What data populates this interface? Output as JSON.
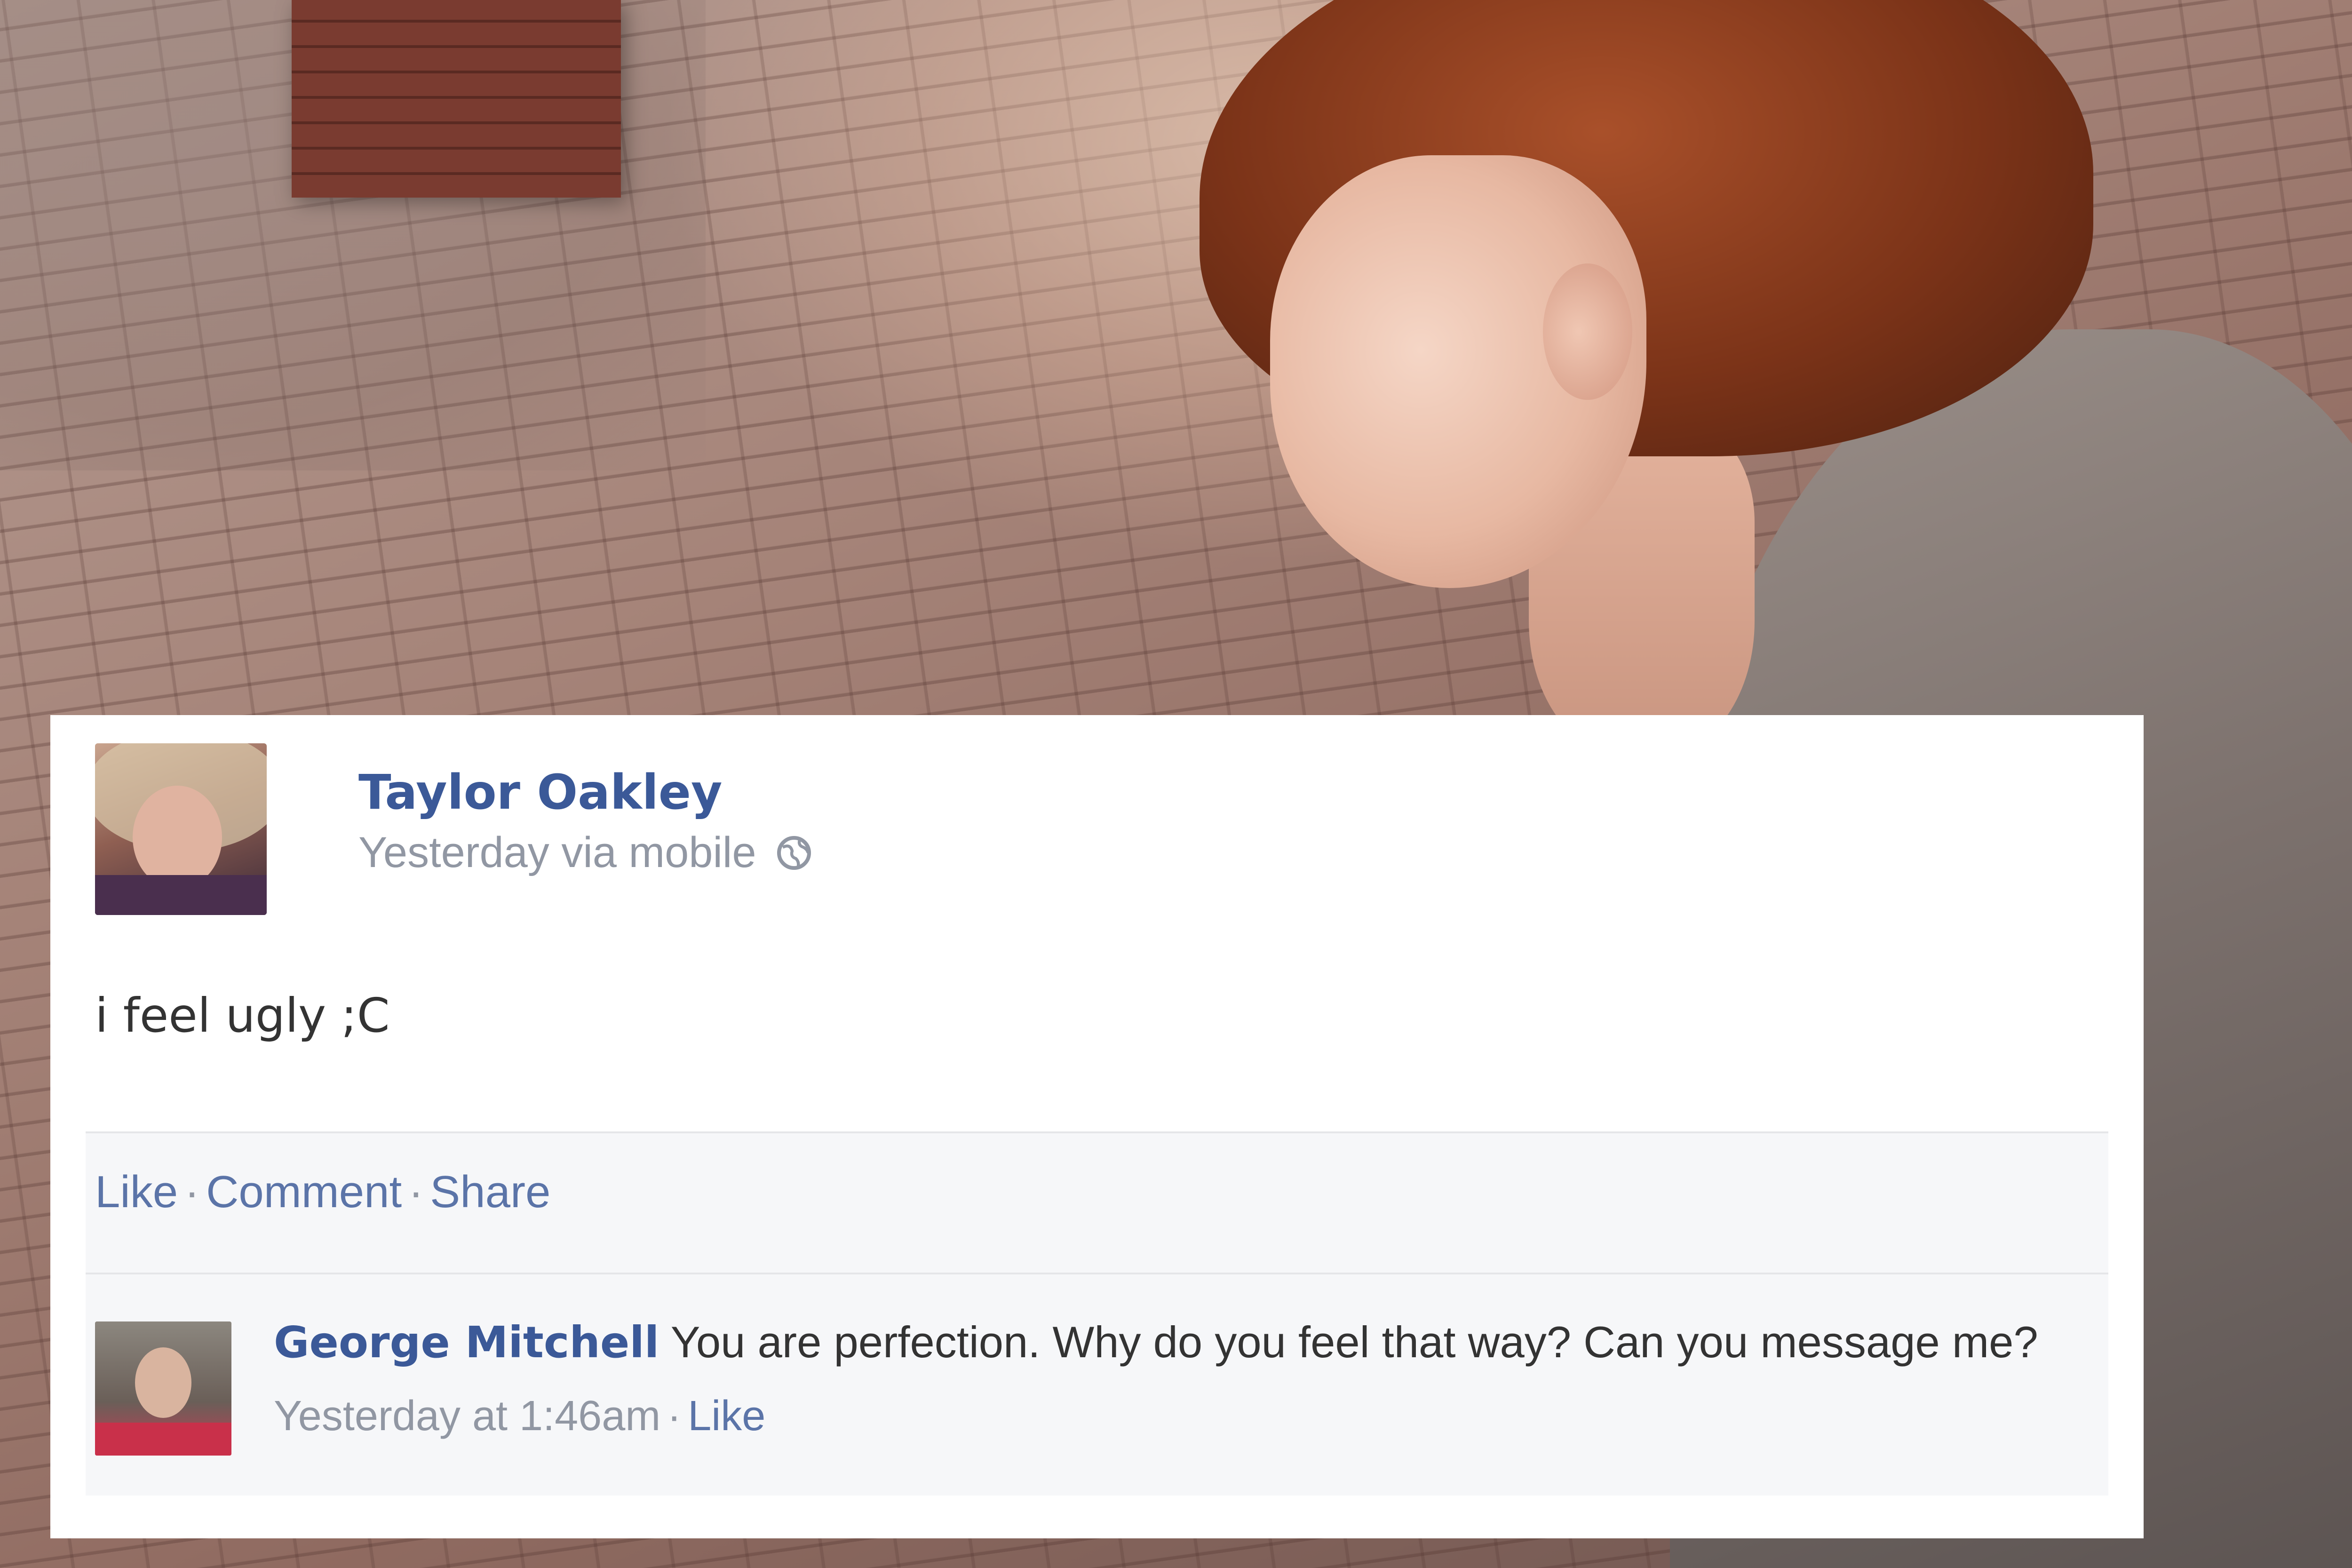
{
  "post": {
    "author_name": "Taylor Oakley",
    "timestamp": "Yesterday via mobile",
    "privacy_icon": "globe-icon",
    "text": "i feel ugly ;C",
    "actions": {
      "like": "Like",
      "comment": "Comment",
      "share": "Share",
      "separator": "·"
    },
    "comments": [
      {
        "author_name": "George Mitchell",
        "text": "You are perfection. Why do you feel that way? Can you message me?",
        "timestamp": "Yesterday at 1:46am",
        "like": "Like"
      }
    ]
  },
  "colors": {
    "link_blue": "#3b5998",
    "action_blue": "#5b74a8",
    "meta_gray": "#9197a3",
    "card_background": "#ffffff",
    "footer_background": "#f6f7f9"
  }
}
